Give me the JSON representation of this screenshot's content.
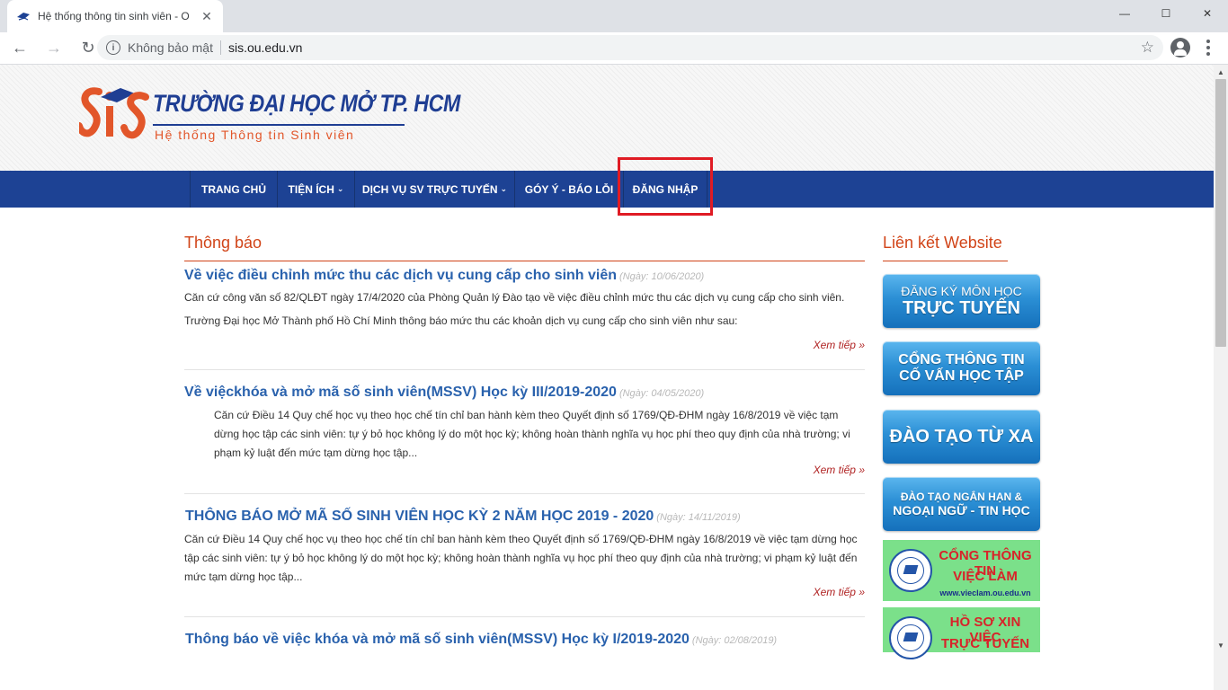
{
  "browser": {
    "tab_title": "Hệ thống thông tin sinh viên - O",
    "tab_close": "✕",
    "win_min": "—",
    "win_max": "☐",
    "win_close": "✕",
    "back": "←",
    "forward": "→",
    "reload": "↻",
    "info": "i",
    "security_text": "Không bảo mật",
    "url": "sis.ou.edu.vn",
    "star": "☆"
  },
  "header": {
    "logo_title": "TRƯỜNG ĐẠI HỌC MỞ TP. HCM",
    "logo_subtitle": "Hệ thống Thông tin Sinh viên"
  },
  "nav": {
    "home": "TRANG CHỦ",
    "utilities": "TIỆN ÍCH",
    "online_services": "DỊCH VỤ SV TRỰC TUYẾN",
    "feedback": "GÓY Ý - BÁO LỖI",
    "login": "ĐĂNG NHẬP",
    "caret": "⌄"
  },
  "main": {
    "section_title": "Thông báo",
    "more_label": "Xem tiếp »",
    "articles": [
      {
        "title": "Về việc điều chỉnh mức thu các dịch vụ cung cấp cho sinh viên",
        "date": "(Ngày: 10/06/2020)",
        "p1": "Căn cứ công văn số 82/QLĐT ngày 17/4/2020 của Phòng Quản lý Đào tạo về việc điều chỉnh mức thu các dịch vụ cung cấp cho sinh viên.",
        "p2": "Trường Đại học Mở Thành phố Hồ Chí Minh thông báo mức thu các khoản dịch vụ cung cấp cho sinh viên như sau:"
      },
      {
        "title": "Về việckhóa và mở mã số sinh viên(MSSV) Học kỳ III/2019-2020",
        "date": "(Ngày: 04/05/2020)",
        "p1": "Căn cứ Điều 14 Quy chế học vụ theo học chế tín chỉ ban hành kèm theo Quyết định số 1769/QĐ-ĐHM ngày 16/8/2019 về việc tạm dừng học tập các sinh viên: tự ý bỏ học không lý do một học kỳ; không hoàn thành nghĩa vụ học phí theo quy định của nhà trường; vi phạm kỷ luật đến mức tạm dừng học tập..."
      },
      {
        "title": "THÔNG BÁO MỞ MÃ SỐ SINH VIÊN HỌC KỲ 2 NĂM HỌC 2019 - 2020",
        "date": "(Ngày: 14/11/2019)",
        "p1": "Căn cứ Điều 14 Quy chế học vụ theo học chế tín chỉ ban hành kèm theo Quyết định số 1769/QĐ-ĐHM ngày 16/8/2019 về việc tạm dừng học tập các sinh viên: tự ý bỏ học không lý do một học kỳ; không hoàn thành nghĩa vụ học phí theo quy định của nhà trường; vi phạm kỷ luật đến mức tạm dừng học tập..."
      },
      {
        "title": "Thông báo về việc khóa và mở mã số sinh viên(MSSV) Học kỳ I/2019-2020",
        "date": "(Ngày: 02/08/2019)"
      }
    ]
  },
  "sidebar": {
    "title": "Liên kết Website",
    "btn1_l1": "ĐĂNG KÝ MÔN HỌC",
    "btn1_l2": "TRỰC TUYẾN",
    "btn2_l1": "CỔNG THÔNG TIN",
    "btn2_l2": "CỐ VẤN HỌC TẬP",
    "btn3": "ĐÀO TẠO TỪ XA",
    "btn4_l1": "ĐÀO TẠO NGẮN HẠN &",
    "btn4_l2": "NGOẠI NGỮ - TIN HỌC",
    "jobs_l1": "CỔNG THÔNG TIN",
    "jobs_l2": "VIỆC LÀM",
    "jobs_url": "www.vieclam.ou.edu.vn",
    "cv_l1": "HỒ SƠ XIN VIỆC",
    "cv_l2": "TRỰC TUYẾN"
  },
  "scrollbar": {
    "up": "▲",
    "down": "▼"
  }
}
